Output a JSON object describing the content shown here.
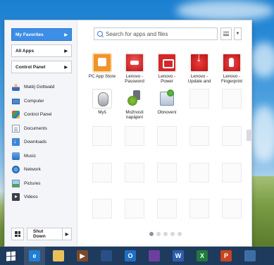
{
  "left_pane": {
    "nav": [
      {
        "label": "My Favorites",
        "active": true
      },
      {
        "label": "All Apps",
        "active": false
      },
      {
        "label": "Control Panel",
        "active": false
      }
    ],
    "places": [
      {
        "label": "Matěj Gottwald",
        "icon": "user-icon"
      },
      {
        "label": "Computer",
        "icon": "computer-icon"
      },
      {
        "label": "Control Panel",
        "icon": "control-panel-icon"
      },
      {
        "label": "Documents",
        "icon": "documents-icon"
      },
      {
        "label": "Downloads",
        "icon": "downloads-icon"
      },
      {
        "label": "Music",
        "icon": "music-icon"
      },
      {
        "label": "Network",
        "icon": "network-icon"
      },
      {
        "label": "Pictures",
        "icon": "pictures-icon"
      },
      {
        "label": "Videos",
        "icon": "videos-icon"
      }
    ],
    "shutdown_label": "Shut Down"
  },
  "search": {
    "placeholder": "Search for apps and files"
  },
  "apps": [
    {
      "line1": "PC App Store",
      "line2": "",
      "icon": "store-icon"
    },
    {
      "line1": "Lenovo -",
      "line2": "Password",
      "icon": "password-icon"
    },
    {
      "line1": "Lenovo -",
      "line2": "Power",
      "icon": "power-icon"
    },
    {
      "line1": "Lenovo -",
      "line2": "Update and",
      "icon": "update-icon"
    },
    {
      "line1": "Lenovo -",
      "line2": "Fingerprint",
      "icon": "fingerprint-icon"
    },
    {
      "line1": "Myš",
      "line2": "",
      "icon": "mouse-icon"
    },
    {
      "line1": "Možnosti",
      "line2": "napájení",
      "icon": "power-options-icon"
    },
    {
      "line1": "Obnovení",
      "line2": "",
      "icon": "recovery-icon"
    }
  ],
  "pagination": {
    "pages": 5,
    "current": 1
  },
  "taskbar": {
    "items": [
      {
        "name": "internet-explorer",
        "color": "#1f7fd6",
        "glyph": "e"
      },
      {
        "name": "file-explorer",
        "color": "#e8c15a",
        "glyph": ""
      },
      {
        "name": "media-player",
        "color": "#7a4a2a",
        "glyph": "▶"
      },
      {
        "name": "blue-app",
        "color": "#2a4f86",
        "glyph": ""
      },
      {
        "name": "outlook",
        "color": "#1f6ec6",
        "glyph": "O"
      },
      {
        "name": "notepad-app",
        "color": "#6b3fa0",
        "glyph": ""
      },
      {
        "name": "word",
        "color": "#2b5fad",
        "glyph": "W"
      },
      {
        "name": "excel",
        "color": "#1f7a3d",
        "glyph": "X"
      },
      {
        "name": "powerpoint",
        "color": "#c9441f",
        "glyph": "P"
      },
      {
        "name": "people-app",
        "color": "#3d6fa5",
        "glyph": ""
      }
    ]
  }
}
